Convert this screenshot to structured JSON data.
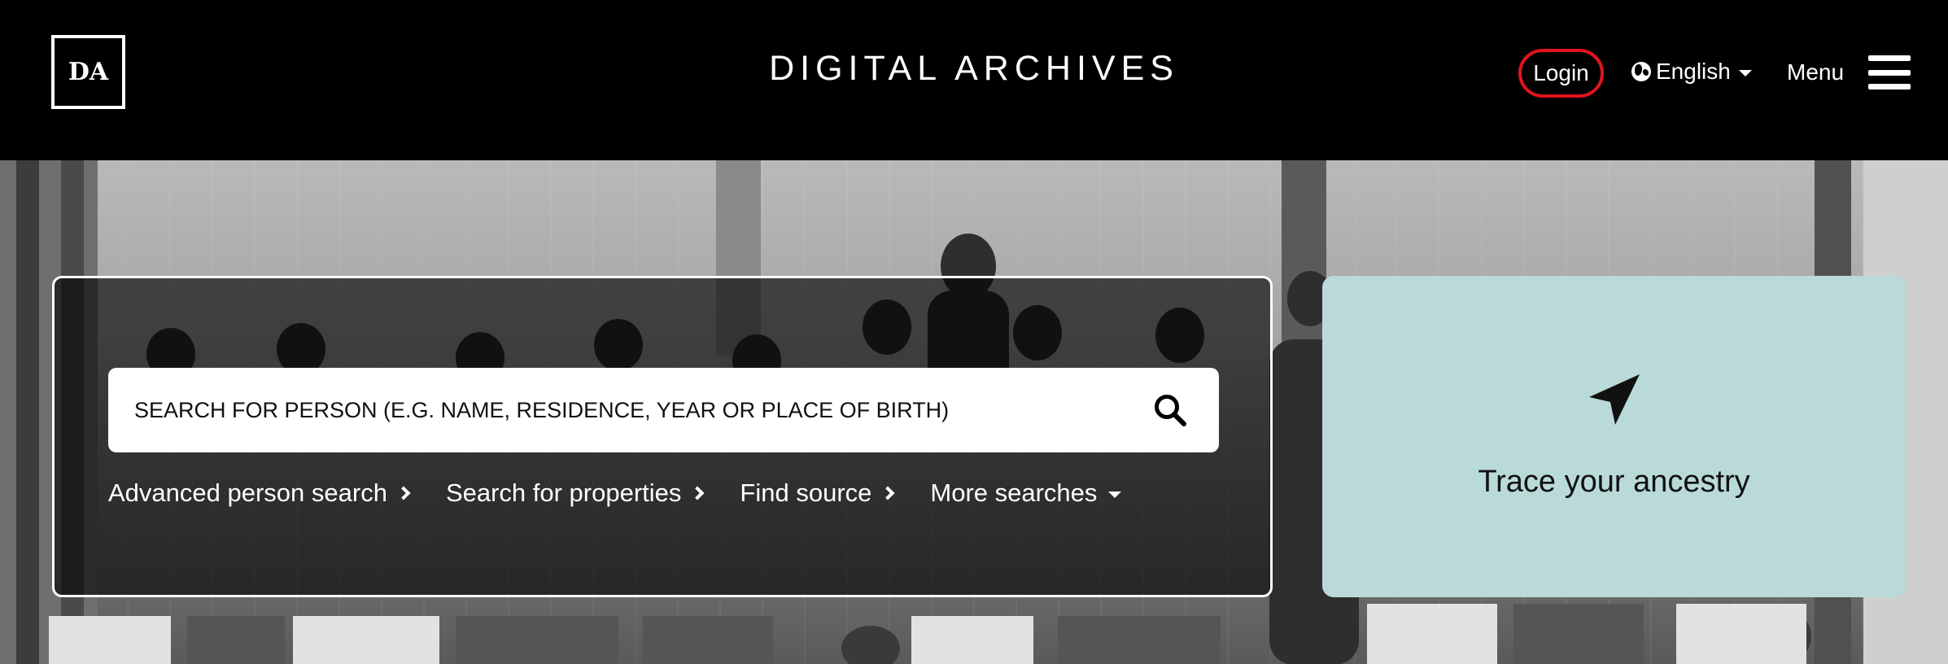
{
  "header": {
    "logo_text": "DA",
    "title": "DIGITAL ARCHIVES",
    "login_label": "Login",
    "language": {
      "label": "English",
      "icon": "globe-icon"
    },
    "menu_label": "Menu",
    "menu_icon": "hamburger-icon"
  },
  "search": {
    "placeholder": "SEARCH FOR PERSON (E.G. NAME, RESIDENCE, YEAR OR PLACE OF BIRTH)",
    "value": "",
    "button_icon": "search-icon",
    "links": [
      {
        "label": "Advanced person search",
        "icon": "chevron-right-icon"
      },
      {
        "label": "Search for properties",
        "icon": "chevron-right-icon"
      },
      {
        "label": "Find source",
        "icon": "chevron-right-icon"
      },
      {
        "label": "More searches",
        "icon": "caret-down-icon"
      }
    ]
  },
  "trace_card": {
    "label": "Trace your ancestry",
    "icon": "navigation-arrow-icon"
  },
  "colors": {
    "header_bg": "#000000",
    "login_highlight": "#e0141e",
    "trace_card_bg": "#b9dad8"
  }
}
